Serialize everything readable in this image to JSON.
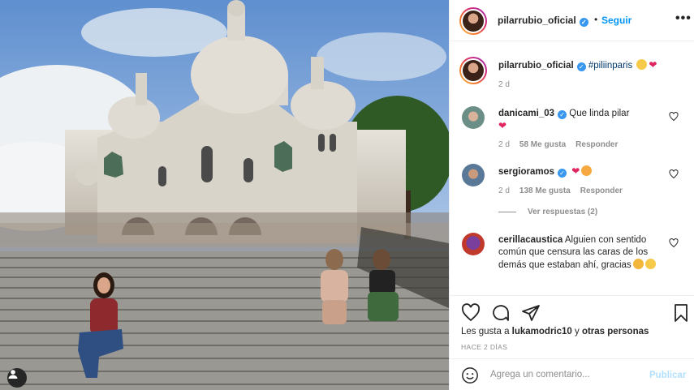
{
  "post": {
    "username": "pilarrubio_oficial",
    "follow_label": "Seguir",
    "separator": "•",
    "more_label": "•••",
    "caption": {
      "username": "pilarrubio_oficial",
      "hashtag": "#piliinparis",
      "time": "2 d"
    }
  },
  "comments": [
    {
      "username": "danicami_03",
      "verified": true,
      "text": "Que linda pilar",
      "time": "2 d",
      "likes": "58 Me gusta",
      "reply_label": "Responder"
    },
    {
      "username": "sergioramos",
      "verified": true,
      "text": "",
      "time": "2 d",
      "likes": "138 Me gusta",
      "reply_label": "Responder",
      "view_replies": "Ver respuestas (2)"
    },
    {
      "username": "cerillacaustica",
      "verified": false,
      "text": "Alguien con sentido común que censura las caras de los demás que estaban ahí, gracias",
      "time": "",
      "likes": "",
      "reply_label": ""
    }
  ],
  "footer": {
    "likes_prefix": "Les gusta a ",
    "likes_user": "lukamodric10",
    "likes_mid": " y ",
    "likes_others": "otras personas",
    "date": "HACE 2 DÍAS",
    "comment_placeholder": "Agrega un comentario...",
    "publish_label": "Publicar"
  },
  "icons": {
    "verified": "verified-badge-icon",
    "like": "heart-icon",
    "comment": "comment-icon",
    "share": "share-icon",
    "save": "bookmark-icon",
    "emoji": "emoji-smile-icon",
    "tag": "user-tag-icon"
  },
  "colors": {
    "link": "#0095f6",
    "verified": "#3897f0",
    "muted": "#8e8e8e",
    "publish_disabled": "#b2dffc"
  }
}
